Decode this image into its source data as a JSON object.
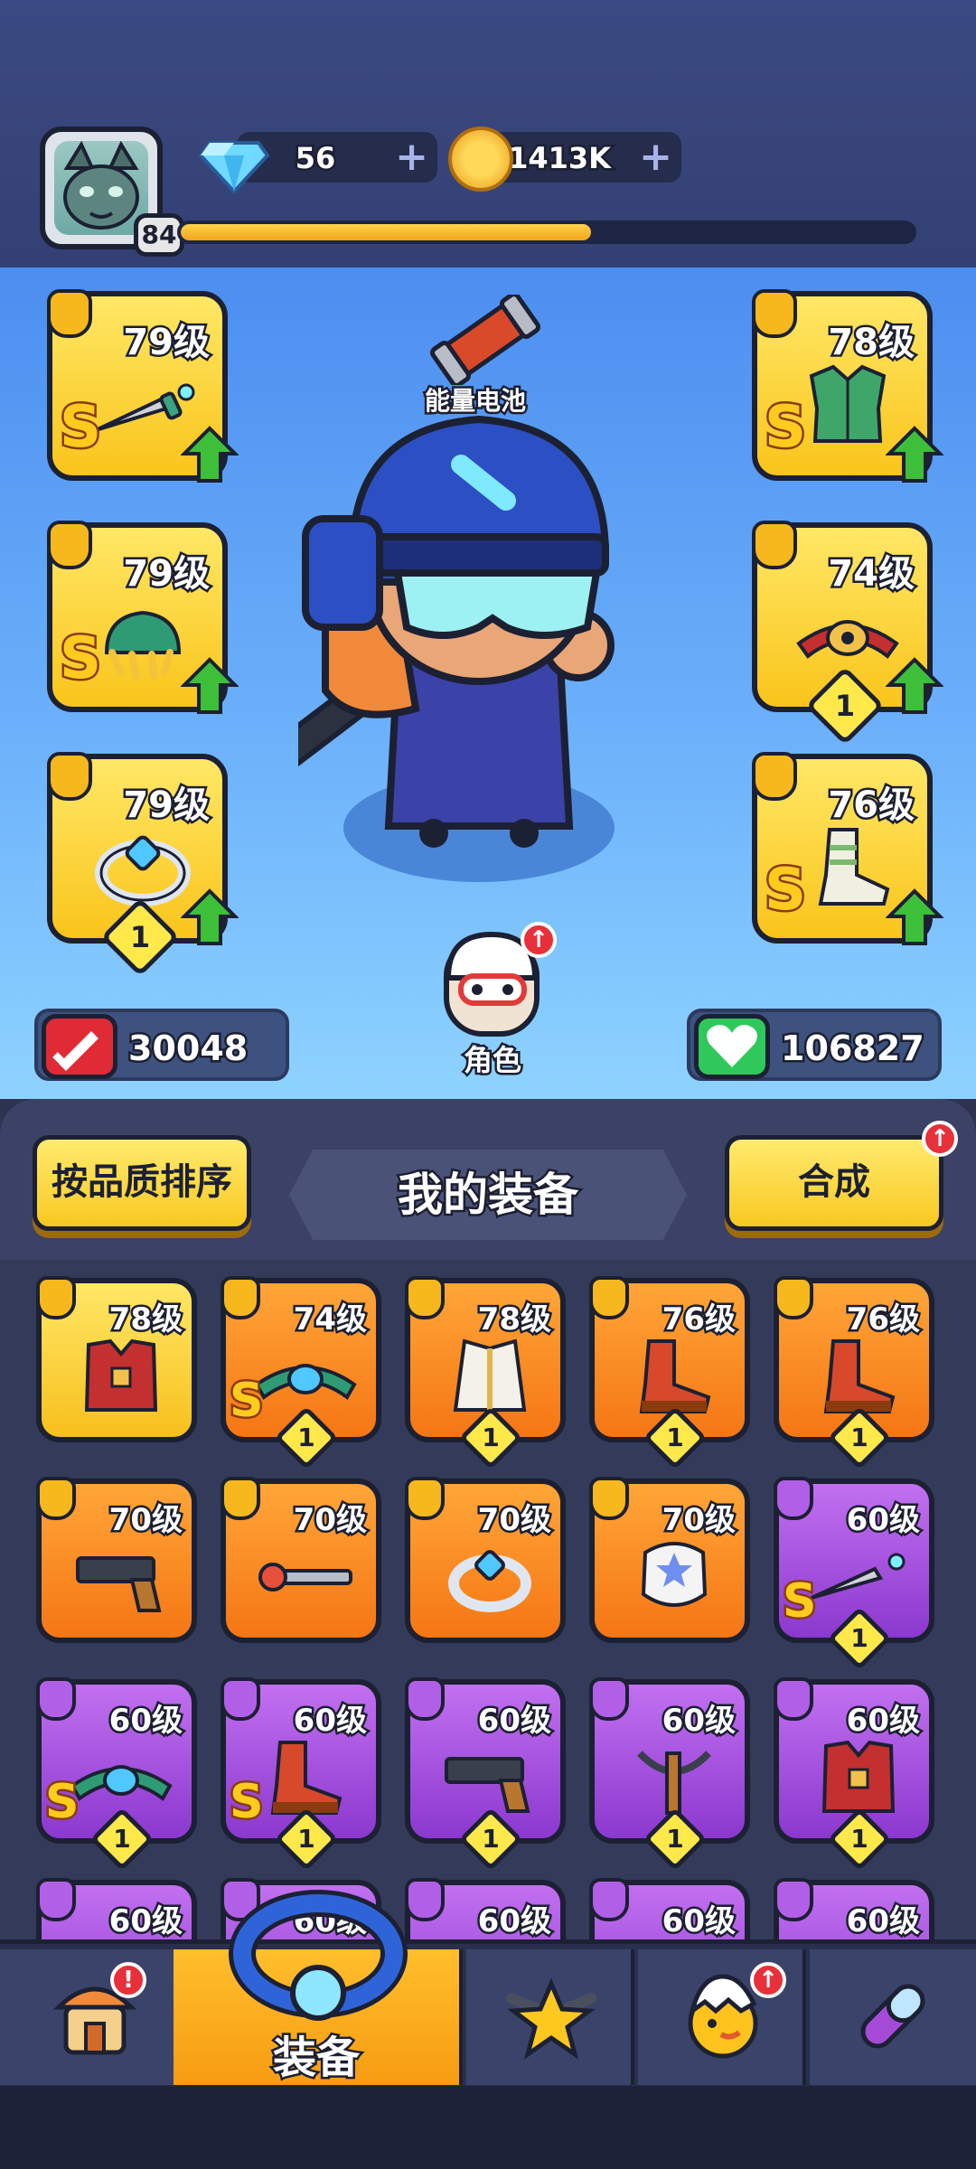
{
  "header": {
    "player_level": "84",
    "xp_progress": 0.56,
    "gems": "56",
    "coins": "1413K",
    "plus": "+"
  },
  "hero": {
    "battery_label": "能量电池",
    "role_label": "角色",
    "attack": "30048",
    "hp": "106827",
    "slots_left": [
      {
        "level": "79级",
        "grade": "S",
        "icon": "dagger-icon",
        "type": "weapon"
      },
      {
        "level": "79级",
        "grade": "S",
        "icon": "gauntlet-icon",
        "type": "glove"
      },
      {
        "level": "79级",
        "stars": "1",
        "icon": "ring-icon",
        "type": "ring"
      }
    ],
    "slots_right": [
      {
        "level": "78级",
        "grade": "S",
        "icon": "armor-icon",
        "type": "armor"
      },
      {
        "level": "74级",
        "stars": "1",
        "icon": "belt-icon",
        "type": "belt"
      },
      {
        "level": "76级",
        "grade": "S",
        "icon": "boots-icon",
        "type": "boots"
      }
    ]
  },
  "inventory": {
    "sort_button": "按品质排序",
    "title": "我的装备",
    "merge_button": "合成",
    "items": [
      {
        "level": "78级",
        "rarity": "gold",
        "stars": "",
        "grade": "",
        "icon": "vest-icon"
      },
      {
        "level": "74级",
        "rarity": "orange",
        "stars": "1",
        "grade": "S",
        "icon": "belt-icon"
      },
      {
        "level": "78级",
        "rarity": "orange",
        "stars": "1",
        "grade": "",
        "icon": "coat-icon"
      },
      {
        "level": "76级",
        "rarity": "orange",
        "stars": "1",
        "grade": "",
        "icon": "boots-icon"
      },
      {
        "level": "76级",
        "rarity": "orange",
        "stars": "1",
        "grade": "",
        "icon": "boots-icon"
      },
      {
        "level": "70级",
        "rarity": "orange",
        "stars": "",
        "grade": "",
        "icon": "pistol-icon"
      },
      {
        "level": "70级",
        "rarity": "orange",
        "stars": "",
        "grade": "",
        "icon": "wand-icon"
      },
      {
        "level": "70级",
        "rarity": "orange",
        "stars": "",
        "grade": "",
        "icon": "ring-icon"
      },
      {
        "level": "70级",
        "rarity": "orange",
        "stars": "",
        "grade": "",
        "icon": "glove-icon"
      },
      {
        "level": "60级",
        "rarity": "purple",
        "stars": "1",
        "grade": "S",
        "icon": "dagger-icon"
      },
      {
        "level": "60级",
        "rarity": "purple",
        "stars": "1",
        "grade": "S",
        "icon": "belt-icon"
      },
      {
        "level": "60级",
        "rarity": "purple",
        "stars": "1",
        "grade": "S",
        "icon": "boots-icon"
      },
      {
        "level": "60级",
        "rarity": "purple",
        "stars": "1",
        "grade": "",
        "icon": "pistol-icon"
      },
      {
        "level": "60级",
        "rarity": "purple",
        "stars": "1",
        "grade": "",
        "icon": "crossbow-icon"
      },
      {
        "level": "60级",
        "rarity": "purple",
        "stars": "1",
        "grade": "",
        "icon": "vest-icon"
      },
      {
        "level": "60级",
        "rarity": "purple",
        "stars": "",
        "grade": "",
        "icon": "vest-icon"
      },
      {
        "level": "60级",
        "rarity": "purple",
        "stars": "",
        "grade": "",
        "icon": "armor-icon"
      },
      {
        "level": "60级",
        "rarity": "purple",
        "stars": "",
        "grade": "",
        "icon": "armor-icon"
      },
      {
        "level": "60级",
        "rarity": "purple",
        "stars": "",
        "grade": "",
        "icon": "ring-icon"
      },
      {
        "level": "60级",
        "rarity": "purple",
        "stars": "",
        "grade": "",
        "icon": "belt-icon"
      }
    ]
  },
  "nav": {
    "items": [
      {
        "icon": "shop-icon",
        "label": "",
        "badge": "!"
      },
      {
        "icon": "equipment-ring-icon",
        "label": "装备",
        "active": true
      },
      {
        "icon": "star-guns-icon",
        "label": ""
      },
      {
        "icon": "pet-egg-icon",
        "label": "",
        "badge": "up"
      },
      {
        "icon": "capsule-icon",
        "label": ""
      }
    ]
  },
  "colors": {
    "gold": "#f9c51b",
    "orange": "#f57614",
    "purple": "#8b38cf",
    "accent_red": "#e8303a",
    "upgrade_green": "#3dbf3a"
  }
}
